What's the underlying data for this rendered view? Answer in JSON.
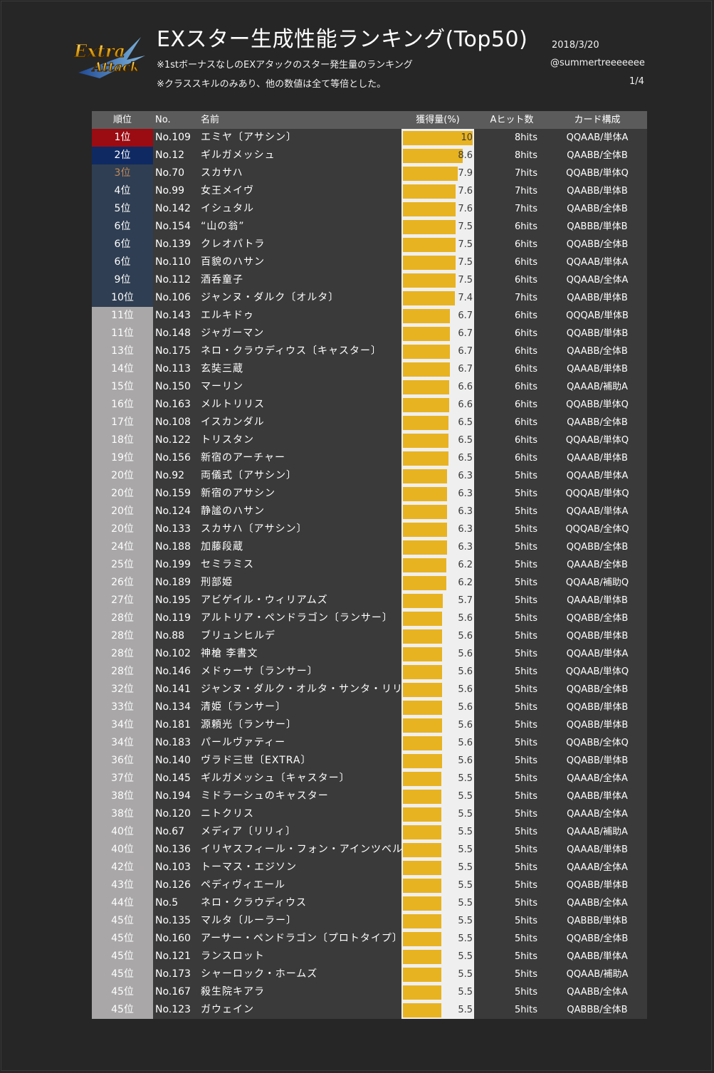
{
  "header": {
    "title": "EXスター生成性能ランキング(Top50)",
    "note1": "※1stボーナスなしのEXアタックのスター発生量のランキング",
    "note2": "※クラススキルのみあり、他の数値は全て等倍とした。",
    "date": "2018/3/20",
    "author": "@summertreeeeeee",
    "page": "1/4",
    "logo_line1": "Extra",
    "logo_line2": "Attack"
  },
  "colors": {
    "background": "#262626",
    "bar": "#e8b321",
    "bar_track": "#efefef",
    "rank1": "#9b0b12",
    "rank2": "#0f2a63",
    "top10": "#2f3e52",
    "rank_other": "#a9a7a7",
    "rank3_text": "#c08a5a"
  },
  "chart_data": {
    "type": "table",
    "title": "EXスター生成性能ランキング(Top50)",
    "columns": [
      "順位",
      "No.",
      "名前",
      "獲得量(%)",
      "Aヒット数",
      "カード構成"
    ],
    "value_column": "獲得量(%)",
    "bar_max": 10,
    "rows": [
      {
        "rank": "1位",
        "no": "No.109",
        "name": "エミヤ〔アサシン〕",
        "value": 10,
        "value_label": "10",
        "hits": "8hits",
        "card": "QQAAB/単体A"
      },
      {
        "rank": "2位",
        "no": "No.12",
        "name": "ギルガメッシュ",
        "value": 8.6,
        "value_label": "8.6",
        "hits": "8hits",
        "card": "QAABB/全体B"
      },
      {
        "rank": "3位",
        "no": "No.70",
        "name": "スカサハ",
        "value": 7.9,
        "value_label": "7.9",
        "hits": "7hits",
        "card": "QQABB/単体Q"
      },
      {
        "rank": "4位",
        "no": "No.99",
        "name": "女王メイヴ",
        "value": 7.6,
        "value_label": "7.6",
        "hits": "7hits",
        "card": "QAABB/単体B"
      },
      {
        "rank": "5位",
        "no": "No.142",
        "name": "イシュタル",
        "value": 7.6,
        "value_label": "7.6",
        "hits": "7hits",
        "card": "QAABB/全体B"
      },
      {
        "rank": "6位",
        "no": "No.154",
        "name": "“山の翁”",
        "value": 7.5,
        "value_label": "7.5",
        "hits": "6hits",
        "card": "QABBB/単体B"
      },
      {
        "rank": "6位",
        "no": "No.139",
        "name": "クレオパトラ",
        "value": 7.5,
        "value_label": "7.5",
        "hits": "6hits",
        "card": "QQABB/全体B"
      },
      {
        "rank": "6位",
        "no": "No.110",
        "name": "百貌のハサン",
        "value": 7.5,
        "value_label": "7.5",
        "hits": "6hits",
        "card": "QQAAB/単体A"
      },
      {
        "rank": "9位",
        "no": "No.112",
        "name": "酒呑童子",
        "value": 7.5,
        "value_label": "7.5",
        "hits": "6hits",
        "card": "QQAAB/全体A"
      },
      {
        "rank": "10位",
        "no": "No.106",
        "name": "ジャンヌ・ダルク〔オルタ〕",
        "value": 7.4,
        "value_label": "7.4",
        "hits": "7hits",
        "card": "QAABB/単体B"
      },
      {
        "rank": "11位",
        "no": "No.143",
        "name": "エルキドゥ",
        "value": 6.7,
        "value_label": "6.7",
        "hits": "6hits",
        "card": "QQQAB/単体B"
      },
      {
        "rank": "11位",
        "no": "No.148",
        "name": "ジャガーマン",
        "value": 6.7,
        "value_label": "6.7",
        "hits": "6hits",
        "card": "QQABB/単体B"
      },
      {
        "rank": "13位",
        "no": "No.175",
        "name": "ネロ・クラウディウス〔キャスター〕",
        "value": 6.7,
        "value_label": "6.7",
        "hits": "6hits",
        "card": "QAABB/全体B"
      },
      {
        "rank": "14位",
        "no": "No.113",
        "name": "玄奘三蔵",
        "value": 6.7,
        "value_label": "6.7",
        "hits": "6hits",
        "card": "QAAAB/単体B"
      },
      {
        "rank": "15位",
        "no": "No.150",
        "name": "マーリン",
        "value": 6.6,
        "value_label": "6.6",
        "hits": "6hits",
        "card": "QAAAB/補助A"
      },
      {
        "rank": "16位",
        "no": "No.163",
        "name": "メルトリリス",
        "value": 6.6,
        "value_label": "6.6",
        "hits": "6hits",
        "card": "QQABB/単体Q"
      },
      {
        "rank": "17位",
        "no": "No.108",
        "name": "イスカンダル",
        "value": 6.5,
        "value_label": "6.5",
        "hits": "6hits",
        "card": "QAABB/全体B"
      },
      {
        "rank": "18位",
        "no": "No.122",
        "name": "トリスタン",
        "value": 6.5,
        "value_label": "6.5",
        "hits": "6hits",
        "card": "QQAAB/単体Q"
      },
      {
        "rank": "19位",
        "no": "No.156",
        "name": "新宿のアーチャー",
        "value": 6.5,
        "value_label": "6.5",
        "hits": "6hits",
        "card": "QAAAB/単体B"
      },
      {
        "rank": "20位",
        "no": "No.92",
        "name": "両儀式〔アサシン〕",
        "value": 6.3,
        "value_label": "6.3",
        "hits": "5hits",
        "card": "QQAAB/単体A"
      },
      {
        "rank": "20位",
        "no": "No.159",
        "name": "新宿のアサシン",
        "value": 6.3,
        "value_label": "6.3",
        "hits": "5hits",
        "card": "QQQAB/単体Q"
      },
      {
        "rank": "20位",
        "no": "No.124",
        "name": "静謐のハサン",
        "value": 6.3,
        "value_label": "6.3",
        "hits": "5hits",
        "card": "QQAAB/単体A"
      },
      {
        "rank": "20位",
        "no": "No.133",
        "name": "スカサハ〔アサシン〕",
        "value": 6.3,
        "value_label": "6.3",
        "hits": "5hits",
        "card": "QQQAB/全体Q"
      },
      {
        "rank": "24位",
        "no": "No.188",
        "name": "加藤段蔵",
        "value": 6.3,
        "value_label": "6.3",
        "hits": "5hits",
        "card": "QQABB/全体B"
      },
      {
        "rank": "25位",
        "no": "No.199",
        "name": "セミラミス",
        "value": 6.2,
        "value_label": "6.2",
        "hits": "5hits",
        "card": "QAAAB/全体B"
      },
      {
        "rank": "26位",
        "no": "No.189",
        "name": "刑部姫",
        "value": 6.2,
        "value_label": "6.2",
        "hits": "5hits",
        "card": "QQAAB/補助Q"
      },
      {
        "rank": "27位",
        "no": "No.195",
        "name": "アビゲイル・ウィリアムズ",
        "value": 5.7,
        "value_label": "5.7",
        "hits": "5hits",
        "card": "QAAAB/単体B"
      },
      {
        "rank": "28位",
        "no": "No.119",
        "name": "アルトリア・ペンドラゴン〔ランサー〕",
        "value": 5.6,
        "value_label": "5.6",
        "hits": "5hits",
        "card": "QQABB/全体B"
      },
      {
        "rank": "28位",
        "no": "No.88",
        "name": "ブリュンヒルデ",
        "value": 5.6,
        "value_label": "5.6",
        "hits": "5hits",
        "card": "QQABB/単体B"
      },
      {
        "rank": "28位",
        "no": "No.102",
        "name": "神槍 李書文",
        "value": 5.6,
        "value_label": "5.6",
        "hits": "5hits",
        "card": "QQAAB/単体A"
      },
      {
        "rank": "28位",
        "no": "No.146",
        "name": "メドゥーサ〔ランサー〕",
        "value": 5.6,
        "value_label": "5.6",
        "hits": "5hits",
        "card": "QQAAB/単体Q"
      },
      {
        "rank": "32位",
        "no": "No.141",
        "name": "ジャンヌ・ダルク・オルタ・サンタ・リリィ",
        "value": 5.6,
        "value_label": "5.6",
        "hits": "5hits",
        "card": "QQABB/全体B"
      },
      {
        "rank": "33位",
        "no": "No.134",
        "name": "清姫〔ランサー〕",
        "value": 5.6,
        "value_label": "5.6",
        "hits": "5hits",
        "card": "QQABB/単体B"
      },
      {
        "rank": "34位",
        "no": "No.181",
        "name": "源頼光〔ランサー〕",
        "value": 5.6,
        "value_label": "5.6",
        "hits": "5hits",
        "card": "QQABB/単体B"
      },
      {
        "rank": "34位",
        "no": "No.183",
        "name": "パールヴァティー",
        "value": 5.6,
        "value_label": "5.6",
        "hits": "5hits",
        "card": "QQABB/全体Q"
      },
      {
        "rank": "36位",
        "no": "No.140",
        "name": "ヴラド三世〔EXTRA〕",
        "value": 5.6,
        "value_label": "5.6",
        "hits": "5hits",
        "card": "QQABB/単体B"
      },
      {
        "rank": "37位",
        "no": "No.145",
        "name": "ギルガメッシュ〔キャスター〕",
        "value": 5.5,
        "value_label": "5.5",
        "hits": "5hits",
        "card": "QAAAB/全体A"
      },
      {
        "rank": "38位",
        "no": "No.194",
        "name": "ミドラーシュのキャスター",
        "value": 5.5,
        "value_label": "5.5",
        "hits": "5hits",
        "card": "QAABB/単体A"
      },
      {
        "rank": "38位",
        "no": "No.120",
        "name": "ニトクリス",
        "value": 5.5,
        "value_label": "5.5",
        "hits": "5hits",
        "card": "QAAAB/全体A"
      },
      {
        "rank": "40位",
        "no": "No.67",
        "name": "メディア〔リリィ〕",
        "value": 5.5,
        "value_label": "5.5",
        "hits": "5hits",
        "card": "QAAAB/補助A"
      },
      {
        "rank": "40位",
        "no": "No.136",
        "name": "イリヤスフィール・フォン・アインツベルン",
        "value": 5.5,
        "value_label": "5.5",
        "hits": "5hits",
        "card": "QAAAB/単体B"
      },
      {
        "rank": "42位",
        "no": "No.103",
        "name": "トーマス・エジソン",
        "value": 5.5,
        "value_label": "5.5",
        "hits": "5hits",
        "card": "QAAAB/全体A"
      },
      {
        "rank": "43位",
        "no": "No.126",
        "name": "ペディヴィエール",
        "value": 5.5,
        "value_label": "5.5",
        "hits": "5hits",
        "card": "QQABB/単体B"
      },
      {
        "rank": "44位",
        "no": "No.5",
        "name": "ネロ・クラウディウス",
        "value": 5.5,
        "value_label": "5.5",
        "hits": "5hits",
        "card": "QAABB/全体A"
      },
      {
        "rank": "45位",
        "no": "No.135",
        "name": "マルタ〔ルーラー〕",
        "value": 5.5,
        "value_label": "5.5",
        "hits": "5hits",
        "card": "QABBB/単体B"
      },
      {
        "rank": "45位",
        "no": "No.160",
        "name": "アーサー・ペンドラゴン〔プロトタイプ〕",
        "value": 5.5,
        "value_label": "5.5",
        "hits": "5hits",
        "card": "QQABB/全体B"
      },
      {
        "rank": "45位",
        "no": "No.121",
        "name": "ランスロット",
        "value": 5.5,
        "value_label": "5.5",
        "hits": "5hits",
        "card": "QAABB/単体A"
      },
      {
        "rank": "45位",
        "no": "No.173",
        "name": "シャーロック・ホームズ",
        "value": 5.5,
        "value_label": "5.5",
        "hits": "5hits",
        "card": "QQAAB/補助A"
      },
      {
        "rank": "45位",
        "no": "No.167",
        "name": "殺生院キアラ",
        "value": 5.5,
        "value_label": "5.5",
        "hits": "5hits",
        "card": "QAABB/全体A"
      },
      {
        "rank": "45位",
        "no": "No.123",
        "name": "ガウェイン",
        "value": 5.5,
        "value_label": "5.5",
        "hits": "5hits",
        "card": "QABBB/全体B"
      }
    ]
  }
}
